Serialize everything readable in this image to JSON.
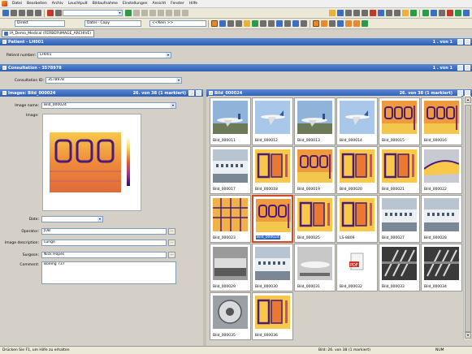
{
  "menubar": {
    "items": [
      "Datei",
      "Bearbeiten",
      "Archiv",
      "Leuchtpult",
      "Bildaufnahme",
      "Einstellungen",
      "Ansicht",
      "Fenster",
      "Hilfe"
    ]
  },
  "toolbar": {
    "direkt": "Direkt",
    "copy": "Datei - Copy",
    "kein": "<<Kein >>"
  },
  "doc_tab": "IA_Demo_Medical (FERBER\\IMAGE_ARCHIVE)",
  "patient": {
    "header": "Patient - LH001",
    "count": "1 . von 1",
    "number_label": "Patient number:",
    "number_value": "LH001"
  },
  "consultation": {
    "header": "Consultation - 3578978",
    "count": "1 . von 1",
    "id_label": "Consultation ID:",
    "id_value": "3578978"
  },
  "images": {
    "header": "Images: Bild_000024",
    "count": "26. von 38 (1 markiert)",
    "name_label": "Image name:",
    "name_value": "Bild_000024",
    "image_label": "Image:",
    "date_label": "Date:",
    "date_value": "",
    "operator_label": "Operator:",
    "operator_value": "JOB",
    "description_label": "Image description:",
    "description_value": "Lunge",
    "surgeon_label": "Surgeon:",
    "surgeon_value": "Nick Hopes",
    "comment_label": "Comment:",
    "comment_value": "Boeing 737"
  },
  "thumbs_panel": {
    "header": "Bild_000024",
    "count": "26. von 38 (1 markiert)"
  },
  "thumbnails": [
    {
      "label": "Bild_000011",
      "kind": "plane"
    },
    {
      "label": "Bild_000012",
      "kind": "plane-sky"
    },
    {
      "label": "Bild_000013",
      "kind": "plane"
    },
    {
      "label": "Bild_000014",
      "kind": "plane-sky"
    },
    {
      "label": "Bild_000015",
      "kind": "thermal-window"
    },
    {
      "label": "Bild_000016",
      "kind": "thermal-window"
    },
    {
      "label": "Bild_000017",
      "kind": "fuselage"
    },
    {
      "label": "Bild_000018",
      "kind": "thermal"
    },
    {
      "label": "Bild_000019",
      "kind": "thermal-window"
    },
    {
      "label": "Bild_000020",
      "kind": "thermal"
    },
    {
      "label": "Bild_000021",
      "kind": "thermal"
    },
    {
      "label": "Bild_000022",
      "kind": "fuselage-thermal"
    },
    {
      "label": "Bild_000023",
      "kind": "thermal-grid"
    },
    {
      "label": "Bild_000024",
      "kind": "thermal-window",
      "selected": true
    },
    {
      "label": "Bild_000025",
      "kind": "thermal"
    },
    {
      "label": "LS-8809",
      "kind": "thermal"
    },
    {
      "label": "Bild_000027",
      "kind": "fuselage"
    },
    {
      "label": "Bild_000028",
      "kind": "fuselage"
    },
    {
      "label": "Bild_000029",
      "kind": "gray"
    },
    {
      "label": "Bild_000030",
      "kind": "fuselage"
    },
    {
      "label": "Bild_000031",
      "kind": "gray-plane"
    },
    {
      "label": "Bild_000032",
      "kind": "pdf"
    },
    {
      "label": "Bild_000033",
      "kind": "xray"
    },
    {
      "label": "Bild_000034",
      "kind": "xray"
    },
    {
      "label": "Bild_000035",
      "kind": "engine"
    },
    {
      "label": "Bild_000036",
      "kind": "thermal"
    }
  ],
  "status": {
    "left": "Drücken Sie F1, um Hilfe zu erhalten",
    "middle": "Bild: 26. von 38 (1 markiert)",
    "right": "NUM"
  },
  "colors": {
    "header_blue": "#2f5fb3",
    "selected_border": "#d04b24",
    "thermal_hot": "#f7c84a",
    "thermal_cold": "#4b1b7a"
  }
}
